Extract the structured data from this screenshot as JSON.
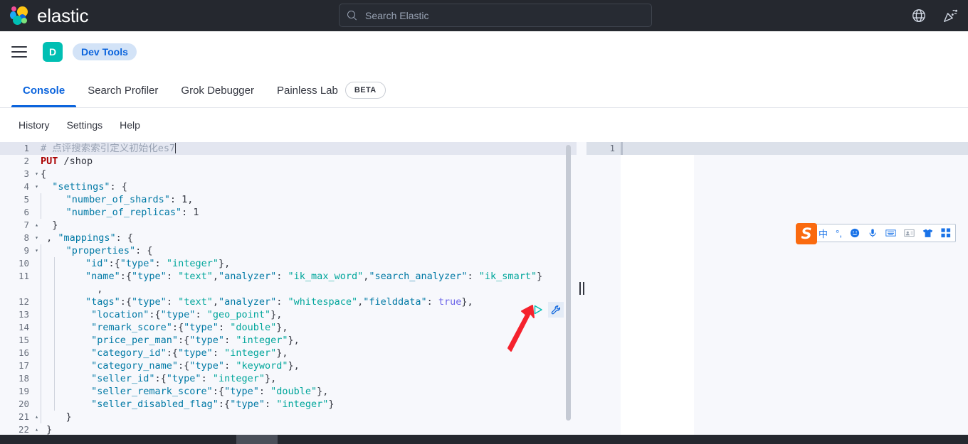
{
  "header": {
    "brand_name": "elastic",
    "logo_icon": "elastic-logo-icon",
    "search": {
      "placeholder": "Search Elastic",
      "value": "",
      "icon": "search-icon"
    },
    "icons": [
      {
        "name": "help-globe-icon",
        "label": "Help"
      },
      {
        "name": "announcements-party-icon",
        "label": "News"
      }
    ]
  },
  "breadcrumb": {
    "menu_icon": "hamburger-menu-icon",
    "space_initial": "D",
    "current": "Dev Tools"
  },
  "tabs": [
    {
      "label": "Console",
      "active": true
    },
    {
      "label": "Search Profiler",
      "active": false
    },
    {
      "label": "Grok Debugger",
      "active": false
    },
    {
      "label": "Painless Lab",
      "active": false,
      "badge": "BETA"
    }
  ],
  "console_actions": [
    {
      "label": "History"
    },
    {
      "label": "Settings"
    },
    {
      "label": "Help"
    }
  ],
  "editor": {
    "run_button": "play-run-icon",
    "wrench_button": "wrench-settings-icon",
    "annotation_arrow": "red-arrow-annotation",
    "lines": [
      {
        "n": "1",
        "fold": "",
        "indent": 0,
        "current": true,
        "tokens": [
          {
            "t": "comment",
            "v": "# 点评搜索索引定义初始化es7"
          }
        ],
        "caret": true
      },
      {
        "n": "2",
        "fold": "",
        "indent": 0,
        "current": false,
        "tokens": [
          {
            "t": "method",
            "v": "PUT"
          },
          {
            "t": "url",
            "v": " /shop"
          }
        ]
      },
      {
        "n": "3",
        "fold": "▾",
        "indent": 0,
        "current": false,
        "tokens": [
          {
            "t": "punc",
            "v": "{"
          }
        ]
      },
      {
        "n": "4",
        "fold": "▾",
        "indent": 0,
        "current": false,
        "tokens": [
          {
            "t": "punc",
            "v": "  "
          },
          {
            "t": "key",
            "v": "\"settings\""
          },
          {
            "t": "punc",
            "v": ": {"
          }
        ]
      },
      {
        "n": "5",
        "fold": "",
        "indent": 1,
        "current": false,
        "tokens": [
          {
            "t": "punc",
            "v": "  "
          },
          {
            "t": "key",
            "v": "\"number_of_shards\""
          },
          {
            "t": "punc",
            "v": ": "
          },
          {
            "t": "num",
            "v": "1"
          },
          {
            "t": "punc",
            "v": ","
          }
        ]
      },
      {
        "n": "6",
        "fold": "",
        "indent": 1,
        "current": false,
        "tokens": [
          {
            "t": "punc",
            "v": "  "
          },
          {
            "t": "key",
            "v": "\"number_of_replicas\""
          },
          {
            "t": "punc",
            "v": ": "
          },
          {
            "t": "num",
            "v": "1"
          }
        ]
      },
      {
        "n": "7",
        "fold": "▴",
        "indent": 0,
        "current": false,
        "tokens": [
          {
            "t": "punc",
            "v": "  }"
          }
        ]
      },
      {
        "n": "8",
        "fold": "▾",
        "indent": 0,
        "current": false,
        "tokens": [
          {
            "t": "punc",
            "v": " , "
          },
          {
            "t": "key",
            "v": "\"mappings\""
          },
          {
            "t": "punc",
            "v": ": {"
          }
        ]
      },
      {
        "n": "9",
        "fold": "▾",
        "indent": 1,
        "current": false,
        "tokens": [
          {
            "t": "punc",
            "v": "  "
          },
          {
            "t": "key",
            "v": "\"properties\""
          },
          {
            "t": "punc",
            "v": ": {"
          }
        ]
      },
      {
        "n": "10",
        "fold": "",
        "indent": 2,
        "current": false,
        "tokens": [
          {
            "t": "punc",
            "v": "   "
          },
          {
            "t": "key",
            "v": "\"id\""
          },
          {
            "t": "punc",
            "v": ":{"
          },
          {
            "t": "key",
            "v": "\"type\""
          },
          {
            "t": "punc",
            "v": ": "
          },
          {
            "t": "str",
            "v": "\"integer\""
          },
          {
            "t": "punc",
            "v": "},"
          }
        ]
      },
      {
        "n": "11",
        "fold": "",
        "indent": 2,
        "current": false,
        "tokens": [
          {
            "t": "punc",
            "v": "   "
          },
          {
            "t": "key",
            "v": "\"name\""
          },
          {
            "t": "punc",
            "v": ":{"
          },
          {
            "t": "key",
            "v": "\"type\""
          },
          {
            "t": "punc",
            "v": ": "
          },
          {
            "t": "str",
            "v": "\"text\""
          },
          {
            "t": "punc",
            "v": ","
          },
          {
            "t": "key",
            "v": "\"analyzer\""
          },
          {
            "t": "punc",
            "v": ": "
          },
          {
            "t": "str",
            "v": "\"ik_max_word\""
          },
          {
            "t": "punc",
            "v": ","
          },
          {
            "t": "key",
            "v": "\"search_analyzer\""
          },
          {
            "t": "punc",
            "v": ": "
          },
          {
            "t": "str",
            "v": "\"ik_smart\""
          },
          {
            "t": "punc",
            "v": "}"
          }
        ]
      },
      {
        "n": "",
        "fold": "",
        "indent": 2,
        "current": false,
        "tokens": [
          {
            "t": "punc",
            "v": "     ,"
          }
        ]
      },
      {
        "n": "12",
        "fold": "",
        "indent": 2,
        "current": false,
        "tokens": [
          {
            "t": "punc",
            "v": "   "
          },
          {
            "t": "key",
            "v": "\"tags\""
          },
          {
            "t": "punc",
            "v": ":{"
          },
          {
            "t": "key",
            "v": "\"type\""
          },
          {
            "t": "punc",
            "v": ": "
          },
          {
            "t": "str",
            "v": "\"text\""
          },
          {
            "t": "punc",
            "v": ","
          },
          {
            "t": "key",
            "v": "\"analyzer\""
          },
          {
            "t": "punc",
            "v": ": "
          },
          {
            "t": "str",
            "v": "\"whitespace\""
          },
          {
            "t": "punc",
            "v": ","
          },
          {
            "t": "key",
            "v": "\"fielddata\""
          },
          {
            "t": "punc",
            "v": ": "
          },
          {
            "t": "bool",
            "v": "true"
          },
          {
            "t": "punc",
            "v": "},"
          }
        ]
      },
      {
        "n": "13",
        "fold": "",
        "indent": 2,
        "current": false,
        "tokens": [
          {
            "t": "punc",
            "v": "    "
          },
          {
            "t": "key",
            "v": "\"location\""
          },
          {
            "t": "punc",
            "v": ":{"
          },
          {
            "t": "key",
            "v": "\"type\""
          },
          {
            "t": "punc",
            "v": ": "
          },
          {
            "t": "str",
            "v": "\"geo_point\""
          },
          {
            "t": "punc",
            "v": "},"
          }
        ]
      },
      {
        "n": "14",
        "fold": "",
        "indent": 2,
        "current": false,
        "tokens": [
          {
            "t": "punc",
            "v": "    "
          },
          {
            "t": "key",
            "v": "\"remark_score\""
          },
          {
            "t": "punc",
            "v": ":{"
          },
          {
            "t": "key",
            "v": "\"type\""
          },
          {
            "t": "punc",
            "v": ": "
          },
          {
            "t": "str",
            "v": "\"double\""
          },
          {
            "t": "punc",
            "v": "},"
          }
        ]
      },
      {
        "n": "15",
        "fold": "",
        "indent": 2,
        "current": false,
        "tokens": [
          {
            "t": "punc",
            "v": "    "
          },
          {
            "t": "key",
            "v": "\"price_per_man\""
          },
          {
            "t": "punc",
            "v": ":{"
          },
          {
            "t": "key",
            "v": "\"type\""
          },
          {
            "t": "punc",
            "v": ": "
          },
          {
            "t": "str",
            "v": "\"integer\""
          },
          {
            "t": "punc",
            "v": "},"
          }
        ]
      },
      {
        "n": "16",
        "fold": "",
        "indent": 2,
        "current": false,
        "tokens": [
          {
            "t": "punc",
            "v": "    "
          },
          {
            "t": "key",
            "v": "\"category_id\""
          },
          {
            "t": "punc",
            "v": ":{"
          },
          {
            "t": "key",
            "v": "\"type\""
          },
          {
            "t": "punc",
            "v": ": "
          },
          {
            "t": "str",
            "v": "\"integer\""
          },
          {
            "t": "punc",
            "v": "},"
          }
        ]
      },
      {
        "n": "17",
        "fold": "",
        "indent": 2,
        "current": false,
        "tokens": [
          {
            "t": "punc",
            "v": "    "
          },
          {
            "t": "key",
            "v": "\"category_name\""
          },
          {
            "t": "punc",
            "v": ":{"
          },
          {
            "t": "key",
            "v": "\"type\""
          },
          {
            "t": "punc",
            "v": ": "
          },
          {
            "t": "str",
            "v": "\"keyword\""
          },
          {
            "t": "punc",
            "v": "},"
          }
        ]
      },
      {
        "n": "18",
        "fold": "",
        "indent": 2,
        "current": false,
        "tokens": [
          {
            "t": "punc",
            "v": "    "
          },
          {
            "t": "key",
            "v": "\"seller_id\""
          },
          {
            "t": "punc",
            "v": ":{"
          },
          {
            "t": "key",
            "v": "\"type\""
          },
          {
            "t": "punc",
            "v": ": "
          },
          {
            "t": "str",
            "v": "\"integer\""
          },
          {
            "t": "punc",
            "v": "},"
          }
        ]
      },
      {
        "n": "19",
        "fold": "",
        "indent": 2,
        "current": false,
        "tokens": [
          {
            "t": "punc",
            "v": "    "
          },
          {
            "t": "key",
            "v": "\"seller_remark_score\""
          },
          {
            "t": "punc",
            "v": ":{"
          },
          {
            "t": "key",
            "v": "\"type\""
          },
          {
            "t": "punc",
            "v": ": "
          },
          {
            "t": "str",
            "v": "\"double\""
          },
          {
            "t": "punc",
            "v": "},"
          }
        ]
      },
      {
        "n": "20",
        "fold": "",
        "indent": 2,
        "current": false,
        "tokens": [
          {
            "t": "punc",
            "v": "    "
          },
          {
            "t": "key",
            "v": "\"seller_disabled_flag\""
          },
          {
            "t": "punc",
            "v": ":{"
          },
          {
            "t": "key",
            "v": "\"type\""
          },
          {
            "t": "punc",
            "v": ": "
          },
          {
            "t": "str",
            "v": "\"integer\""
          },
          {
            "t": "punc",
            "v": "}"
          }
        ]
      },
      {
        "n": "21",
        "fold": "▴",
        "indent": 1,
        "current": false,
        "tokens": [
          {
            "t": "punc",
            "v": "  }"
          }
        ]
      },
      {
        "n": "22",
        "fold": "▴",
        "indent": 0,
        "current": false,
        "tokens": [
          {
            "t": "punc",
            "v": " }"
          }
        ]
      }
    ]
  },
  "response": {
    "line_number": "1",
    "content": ""
  },
  "ime_toolbar": {
    "logo": "sogou-logo-icon",
    "items": [
      {
        "name": "chinese-mode-icon",
        "glyph": "中"
      },
      {
        "name": "punctuation-mode-icon",
        "glyph": "°,"
      },
      {
        "name": "emoji-icon",
        "glyph": "☺"
      },
      {
        "name": "voice-input-icon",
        "glyph": "🎤"
      },
      {
        "name": "soft-keyboard-icon",
        "glyph": "⌨"
      },
      {
        "name": "user-center-icon",
        "glyph": "👤"
      },
      {
        "name": "skin-shirt-icon",
        "glyph": "👕"
      },
      {
        "name": "toolbox-grid-icon",
        "glyph": "▦"
      }
    ]
  },
  "colors": {
    "header_bg": "#25282f",
    "accent_blue": "#0b64dd",
    "space_teal": "#00bfb3",
    "json_key": "#0079a5",
    "json_string": "#00a69b",
    "method_put": "#aa0000",
    "annotation_red": "#f5222d"
  }
}
